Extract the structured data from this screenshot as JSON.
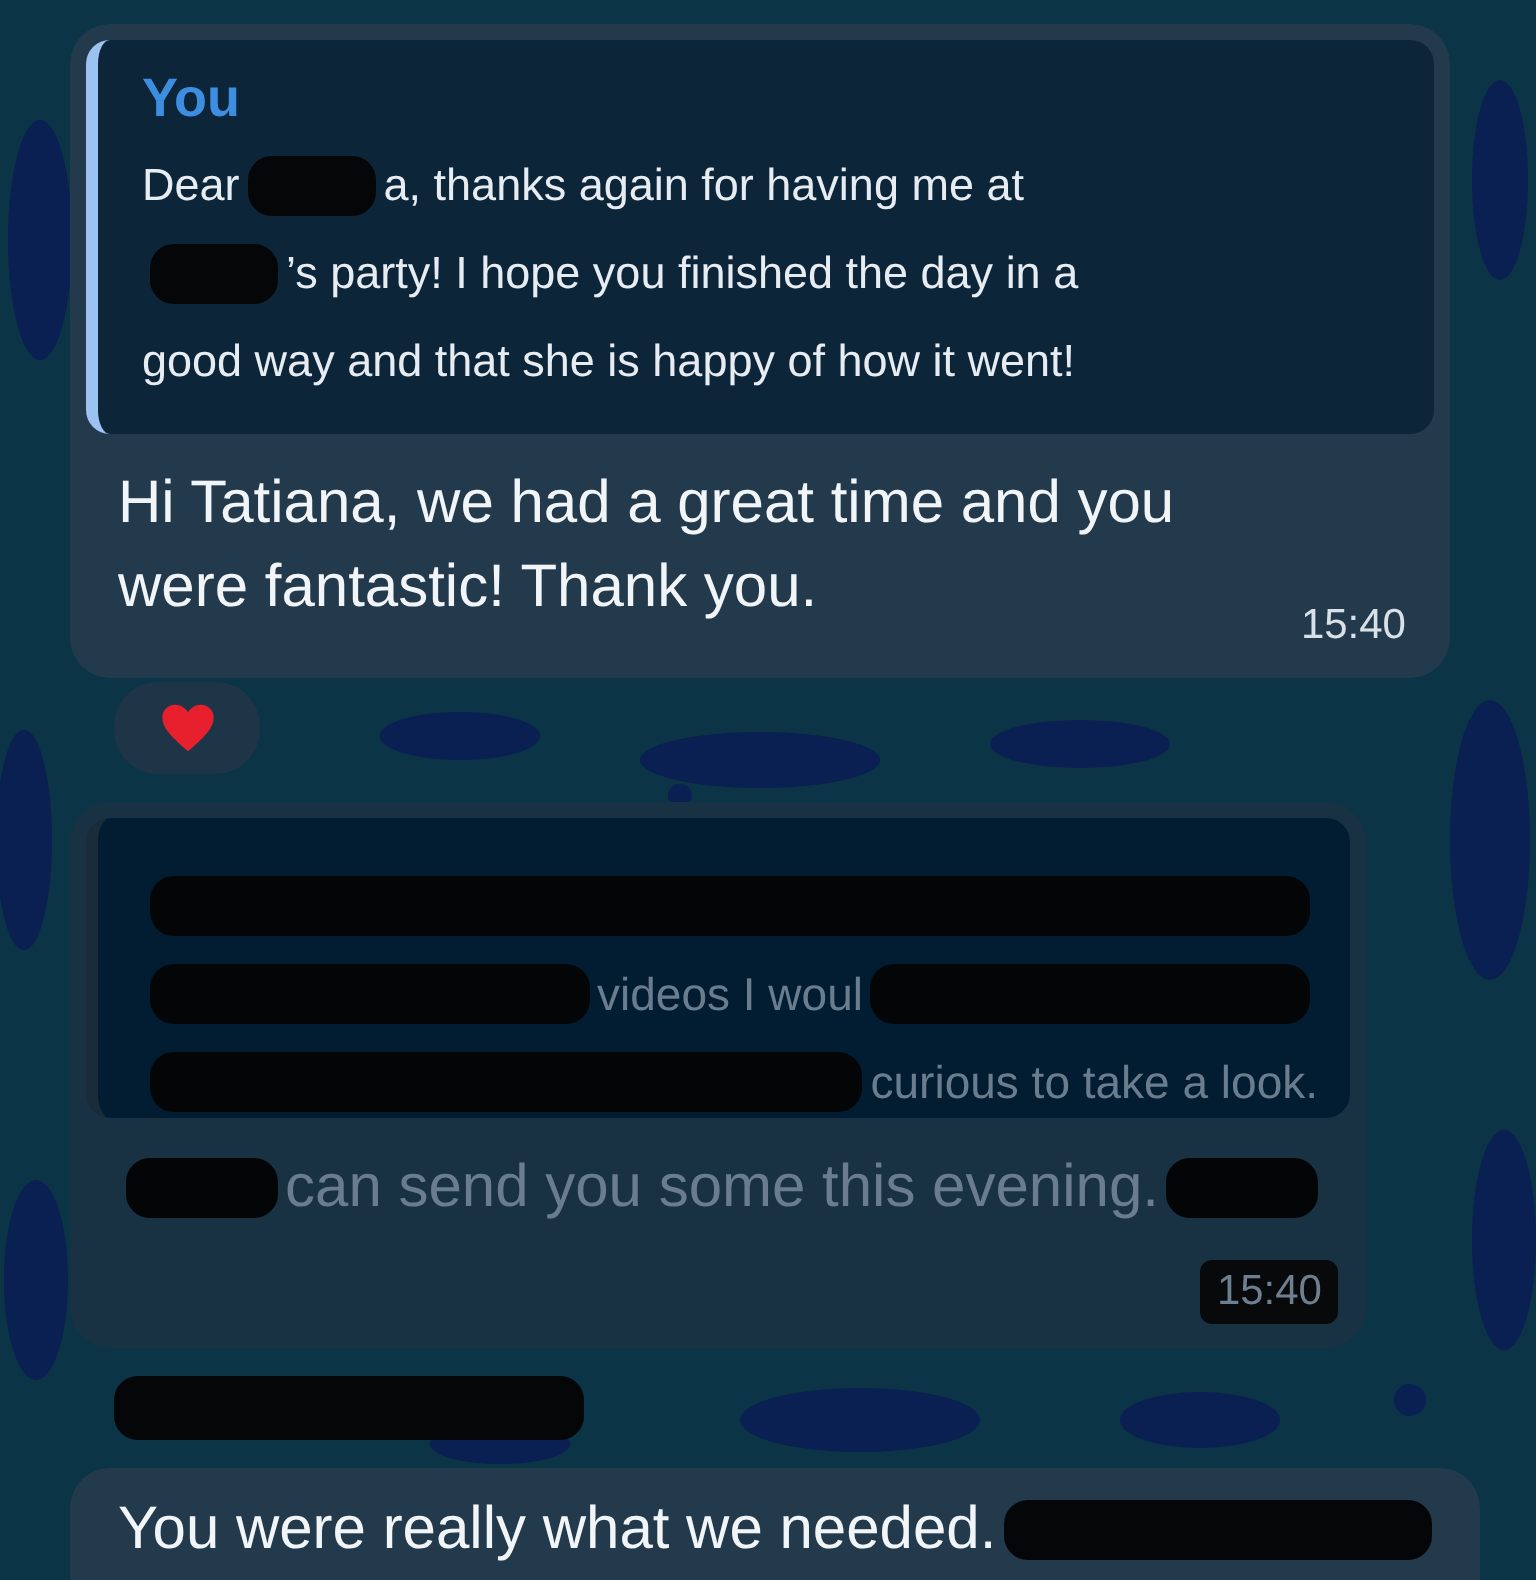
{
  "messages": [
    {
      "kind": "bubble",
      "dimmed": false,
      "reply": {
        "author": "You",
        "lines": [
          [
            {
              "kind": "text",
              "text": "Dear"
            },
            {
              "kind": "redaction"
            },
            {
              "kind": "text",
              "text": "a, thanks again for having me at"
            }
          ],
          [
            {
              "kind": "redaction"
            },
            {
              "kind": "text",
              "text": "’s party! I hope you finished the day in a"
            }
          ],
          [
            {
              "kind": "text",
              "text": "good way and that she is happy of how it went!"
            }
          ]
        ]
      },
      "lines": [
        [
          {
            "kind": "text",
            "text": "Hi Tatiana, we had a great time and you"
          }
        ],
        [
          {
            "kind": "text",
            "text": "were fantastic! Thank you."
          }
        ]
      ],
      "time": "15:40",
      "reactions": [
        {
          "kind": "heart"
        }
      ]
    },
    {
      "kind": "bubble",
      "dimmed": true,
      "reply": {
        "lines": [
          [
            {
              "kind": "redaction"
            }
          ],
          [
            {
              "kind": "redaction"
            },
            {
              "kind": "text",
              "text": "videos I woul"
            },
            {
              "kind": "redaction"
            }
          ],
          [
            {
              "kind": "redaction"
            },
            {
              "kind": "text",
              "text": "curious to take a look."
            }
          ]
        ]
      },
      "lines": [
        [
          {
            "kind": "redaction"
          },
          {
            "kind": "text",
            "text": "can send you some this evening."
          },
          {
            "kind": "redaction"
          }
        ]
      ],
      "time": "15:40"
    },
    {
      "kind": "redaction_mark"
    },
    {
      "kind": "bubble",
      "dimmed": false,
      "lines": [
        [
          {
            "kind": "text",
            "text": "You were really what we needed."
          },
          {
            "kind": "redaction"
          }
        ]
      ]
    }
  ]
}
